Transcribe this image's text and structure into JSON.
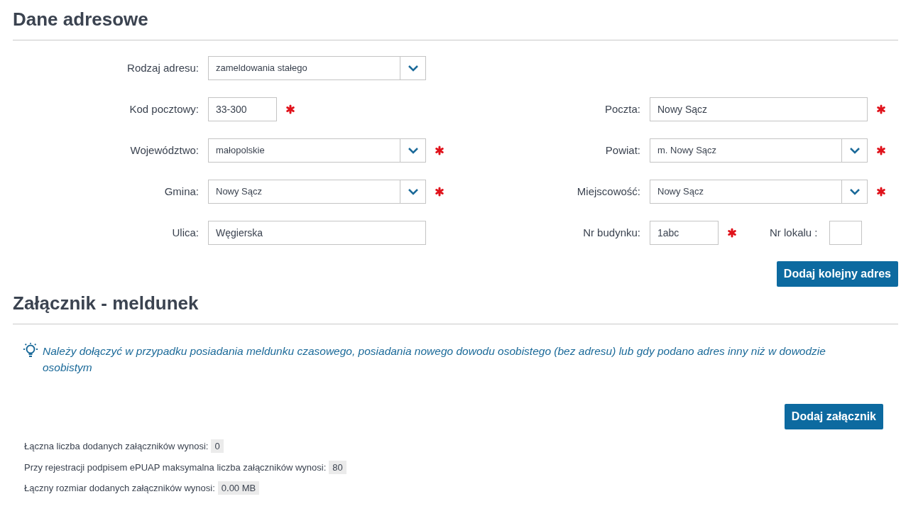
{
  "address_section": {
    "title": "Dane adresowe",
    "rows": [
      {
        "left": [
          {
            "label": "Rodzaj adresu:",
            "kind": "select",
            "value": "zameldowania stałego",
            "required": false
          }
        ],
        "right": []
      },
      {
        "left": [
          {
            "label": "Kod pocztowy:",
            "kind": "short-text",
            "value": "33-300",
            "required": true
          }
        ],
        "right": [
          {
            "label": "Poczta:",
            "kind": "text",
            "value": "Nowy Sącz",
            "required": true
          }
        ]
      },
      {
        "left": [
          {
            "label": "Województwo:",
            "kind": "select",
            "value": "małopolskie",
            "required": true
          }
        ],
        "right": [
          {
            "label": "Powiat:",
            "kind": "select",
            "value": "m. Nowy Sącz",
            "required": true
          }
        ]
      },
      {
        "left": [
          {
            "label": "Gmina:",
            "kind": "select",
            "value": "Nowy Sącz",
            "required": true
          }
        ],
        "right": [
          {
            "label": "Miejscowość:",
            "kind": "select",
            "value": "Nowy Sącz",
            "required": true
          }
        ]
      },
      {
        "left": [
          {
            "label": "Ulica:",
            "kind": "text",
            "value": "Węgierska",
            "required": false
          }
        ],
        "right": [
          {
            "label": "Nr budynku:",
            "kind": "short-text",
            "value": "1abc",
            "required": true
          },
          {
            "label": "Nr lokalu :",
            "kind": "tiny-text",
            "required": false
          }
        ]
      }
    ],
    "add_button": "Dodaj kolejny adres"
  },
  "attachment_section": {
    "title": "Załącznik - meldunek",
    "info": "Należy dołączyć w przypadku posiadania meldunku czasowego, posiadania nowego dowodu osobistego (bez adresu) lub gdy podano adres inny niż w dowodzie osobistym",
    "add_button": "Dodaj załącznik",
    "stats": [
      {
        "label": "Łączna liczba dodanych załączników wynosi:",
        "value": "0"
      },
      {
        "label": "Przy rejestracji podpisem ePUAP maksymalna liczba załączników wynosi:",
        "value": "80"
      },
      {
        "label": "Łączny rozmiar dodanych załączników wynosi:",
        "value": "0.00 MB"
      }
    ]
  }
}
